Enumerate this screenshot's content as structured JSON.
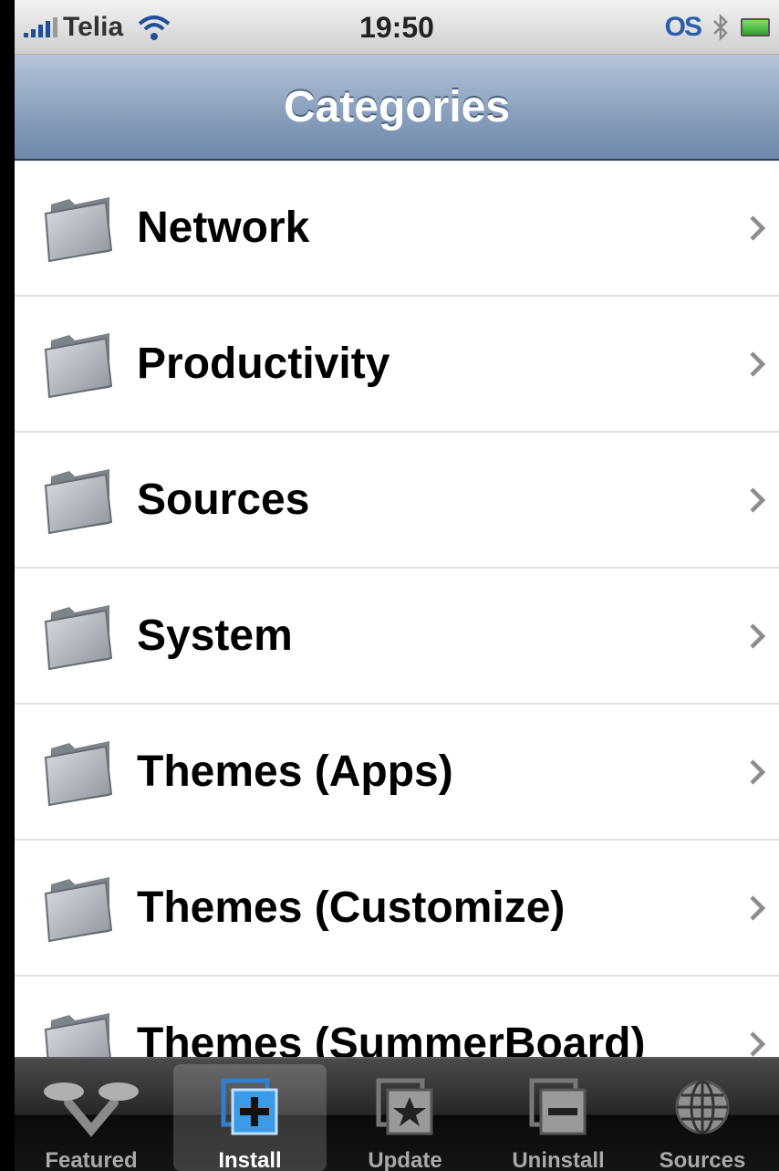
{
  "status_bar": {
    "carrier": "Telia",
    "time": "19:50",
    "extra_icon_text": "OS"
  },
  "nav": {
    "title": "Categories"
  },
  "categories": [
    {
      "label": "Network"
    },
    {
      "label": "Productivity"
    },
    {
      "label": "Sources"
    },
    {
      "label": "System"
    },
    {
      "label": "Themes (Apps)"
    },
    {
      "label": "Themes (Customize)"
    },
    {
      "label": "Themes (SummerBoard)"
    }
  ],
  "tabs": [
    {
      "label": "Featured",
      "icon": "featured-icon",
      "active": false
    },
    {
      "label": "Install",
      "icon": "install-icon",
      "active": true
    },
    {
      "label": "Update",
      "icon": "update-icon",
      "active": false
    },
    {
      "label": "Uninstall",
      "icon": "uninstall-icon",
      "active": false
    },
    {
      "label": "Sources",
      "icon": "sources-globe-icon",
      "active": false
    }
  ],
  "colors": {
    "nav_bar": "#8aa0bd",
    "active_tab_icon": "#3b9be8"
  }
}
